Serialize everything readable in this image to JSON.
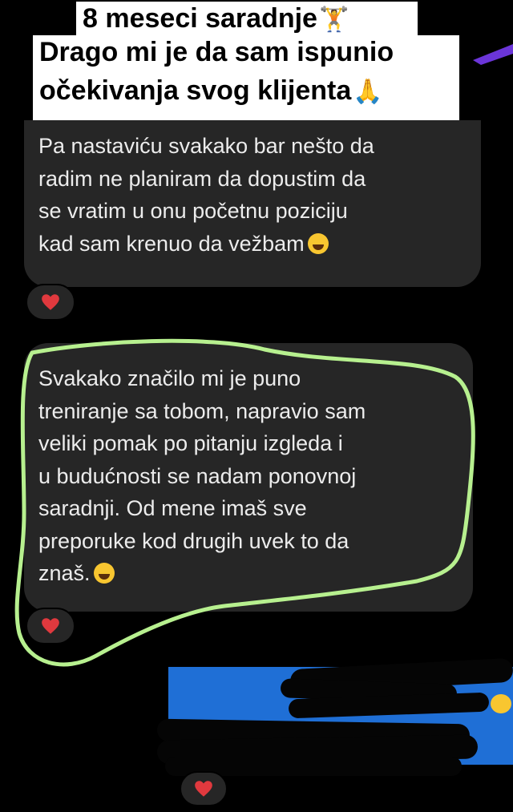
{
  "caption": {
    "lines": [
      "8 meseci saradnje",
      "Drago mi je da sam ispunio",
      "očekivanja svog klijenta"
    ],
    "line1_emoji": "weightlifter-emoji",
    "line3_emoji": "folded-hands-emoji"
  },
  "messages": [
    {
      "lines": [
        "Pa nastaviću svakako bar nešto da",
        "radim ne planiram da dopustim da",
        "se vratim u onu početnu poziciju",
        "kad sam krenuo da vežbam"
      ],
      "emoji": "laughing-tears-emoji",
      "reaction": "heart-icon"
    },
    {
      "lines": [
        "Svakako značilo mi je puno",
        "treniranje sa tobom, napravio sam",
        "veliki pomak po pitanju izgleda i",
        "u budućnosti se nadam ponovnoj",
        "saradnji. Od mene imaš sve",
        "preporuke kod drugih uvek to da",
        "znaš."
      ],
      "emoji": "grinning-emoji",
      "reaction": "heart-icon",
      "highlighted": true
    }
  ],
  "colors": {
    "background": "#000000",
    "bubble": "#262626",
    "text": "#ececec",
    "highlight_outline": "#b7f08f",
    "reaction_heart": "#e0393e",
    "blue_message": "#1f6fd6",
    "purple_accent": "#6b35d8"
  }
}
